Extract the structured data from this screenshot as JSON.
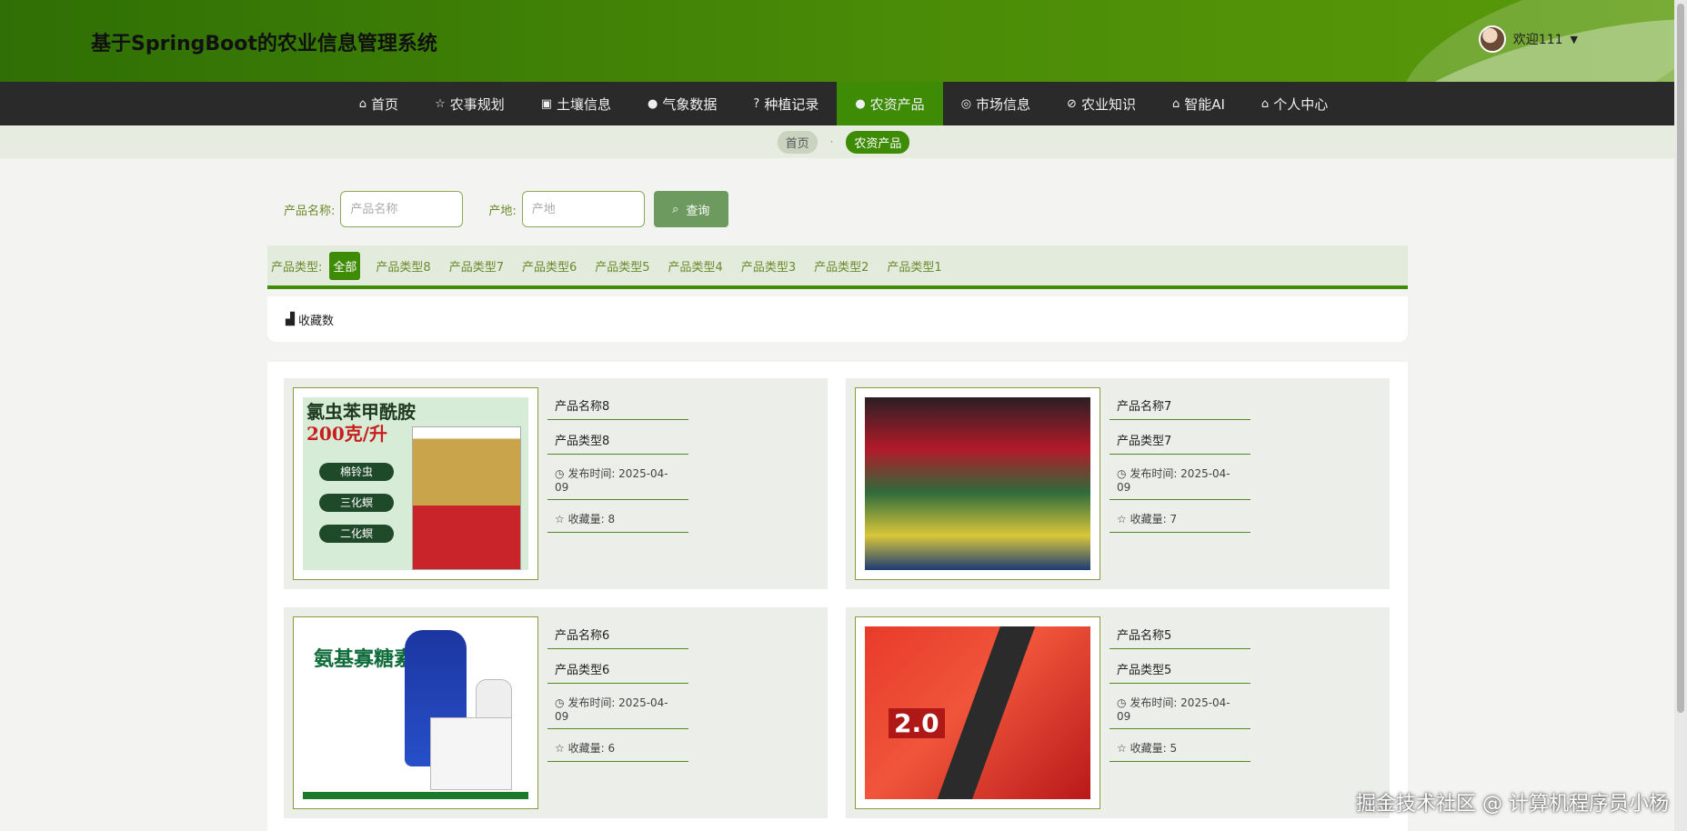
{
  "header": {
    "title": "基于SpringBoot的农业信息管理系统",
    "user_label": "欢迎111"
  },
  "nav": [
    {
      "label": "首页",
      "icon": "home-icon",
      "glyph": "⌂"
    },
    {
      "label": "农事规划",
      "icon": "star-icon",
      "glyph": "☆"
    },
    {
      "label": "土壤信息",
      "icon": "bag-icon",
      "glyph": "▣"
    },
    {
      "label": "气象数据",
      "icon": "info-icon",
      "glyph": "●"
    },
    {
      "label": "种植记录",
      "icon": "question-icon",
      "glyph": "?"
    },
    {
      "label": "农资产品",
      "icon": "info-icon",
      "glyph": "●"
    },
    {
      "label": "市场信息",
      "icon": "circle-icon",
      "glyph": "◎"
    },
    {
      "label": "农业知识",
      "icon": "compass-icon",
      "glyph": "⊘"
    },
    {
      "label": "智能AI",
      "icon": "home-icon",
      "glyph": "⌂"
    },
    {
      "label": "个人中心",
      "icon": "home-icon",
      "glyph": "⌂"
    }
  ],
  "nav_active_index": 5,
  "breadcrumb": {
    "home": "首页",
    "current": "农资产品"
  },
  "search": {
    "name_label": "产品名称:",
    "name_placeholder": "产品名称",
    "origin_label": "产地:",
    "origin_placeholder": "产地",
    "button_label": "查询"
  },
  "types": {
    "label": "产品类型:",
    "items": [
      "全部",
      "产品类型8",
      "产品类型7",
      "产品类型6",
      "产品类型5",
      "产品类型4",
      "产品类型3",
      "产品类型2",
      "产品类型1"
    ]
  },
  "sort": {
    "label": "收藏数"
  },
  "products": [
    {
      "name": "产品名称8",
      "type": "产品类型8",
      "date_label": "发布时间: 2025-04-09",
      "fav_label": "收藏量: 8",
      "art": {
        "title1": "氯虫苯甲酰胺",
        "title2": "200克/升",
        "pills": [
          "棉铃虫",
          "三化螟",
          "二化螟"
        ]
      }
    },
    {
      "name": "产品名称7",
      "type": "产品类型7",
      "date_label": "发布时间: 2025-04-09",
      "fav_label": "收藏量: 7"
    },
    {
      "name": "产品名称6",
      "type": "产品类型6",
      "date_label": "发布时间: 2025-04-09",
      "fav_label": "收藏量: 6",
      "art": {
        "title": "氨基寡糖素"
      }
    },
    {
      "name": "产品名称5",
      "type": "产品类型5",
      "date_label": "发布时间: 2025-04-09",
      "fav_label": "收藏量: 5",
      "art": {
        "num": "2.0"
      }
    }
  ],
  "watermark": "掘金技术社区 @ 计算机程序员小杨",
  "colors": {
    "primary": "#3e8b06",
    "nav_bg": "#2a2a2a",
    "label_green": "#6b8a2b"
  }
}
